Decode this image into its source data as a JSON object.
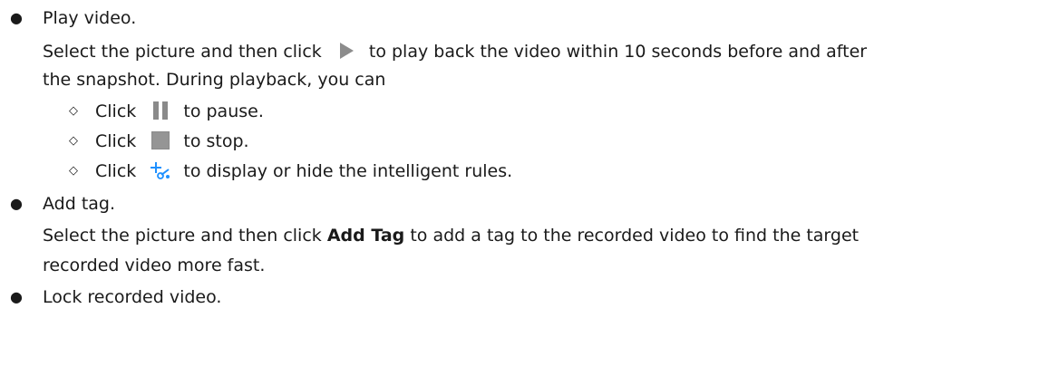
{
  "items": {
    "play": {
      "title": "Play video.",
      "desc_before": "Select the picture and then click",
      "desc_after": "to play back the video within 10 seconds before and after",
      "desc_line2": "the snapshot. During playback, you can",
      "icon": "play-triangle-icon",
      "sub": [
        {
          "before": "Click",
          "icon": "pause-icon",
          "after": "to pause."
        },
        {
          "before": "Click",
          "icon": "stop-icon",
          "after": "to stop."
        },
        {
          "before": "Click",
          "icon": "intelligent-rules-icon",
          "after": "to display or hide the intelligent rules."
        }
      ]
    },
    "tag": {
      "title": "Add tag.",
      "desc_before": "Select the picture and then click",
      "desc_bold": "Add Tag",
      "desc_after": "to add a tag to the recorded video to find the target",
      "desc_line2": "recorded video more fast."
    },
    "lock": {
      "title": "Lock recorded video."
    }
  },
  "bullets": {
    "dot": "●",
    "diamond": "◇"
  },
  "colors": {
    "text": "#1a1a1a",
    "icon_gray": "#9a9a9a",
    "icon_blue": "#1e90ff"
  }
}
